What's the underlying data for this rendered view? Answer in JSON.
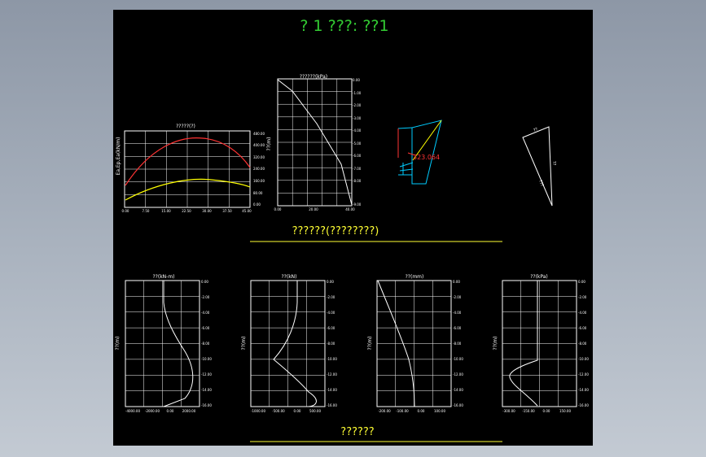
{
  "sheet_title": "? 1 ???: ??1",
  "section1_title": "??????(????????)",
  "section2_title": "??????",
  "colors": {
    "background": "#000000",
    "title_green": "#33cc33",
    "section_yellow": "#ffff33",
    "grid": "#ffffff",
    "curve": "#ffffff",
    "earth_red": "#ff3333",
    "earth_yellow": "#ffff00",
    "wall_cyan": "#00ccff",
    "callout_red": "#ff3333"
  },
  "charts": {
    "earth": {
      "title": "?????(?)",
      "ylabel": "Ea,Ep,Ea(kN/m)",
      "xticks": [
        "0.00",
        "7.50",
        "15.00",
        "22.50",
        "30.00",
        "37.50",
        "45.00"
      ],
      "yticks": [
        "480.00",
        "400.00",
        "320.00",
        "240.00",
        "160.00",
        "80.00",
        "0.00"
      ]
    },
    "pressure": {
      "title": "??????(kPa)",
      "ylabel": "??(m)",
      "xticks": [
        "0.00",
        "20.00",
        "40.00"
      ],
      "yticks": [
        "0.00",
        "-1.00",
        "-2.00",
        "-3.00",
        "-4.00",
        "-5.00",
        "-6.00",
        "-7.00",
        "-8.00",
        "-9.00"
      ]
    },
    "moment": {
      "title": "??(kN-m)",
      "ylabel": "??(m)",
      "xticks": [
        "-4000.00",
        "-2000.00",
        "0.00",
        "2000.00"
      ],
      "yticks": [
        "0.00",
        "-2.00",
        "-4.00",
        "-6.00",
        "-8.00",
        "-10.00",
        "-12.00",
        "-14.00",
        "-16.00"
      ]
    },
    "shear": {
      "title": "??(kN)",
      "ylabel": "??(m)",
      "xticks": [
        "-1000.00",
        "-500.00",
        "0.00",
        "500.00"
      ],
      "yticks": [
        "0.00",
        "-2.00",
        "-4.00",
        "-6.00",
        "-8.00",
        "-10.00",
        "-12.00",
        "-14.00",
        "-16.00"
      ]
    },
    "displacement": {
      "title": "??(mm)",
      "ylabel": "??(m)",
      "xticks": [
        "-200.00",
        "-100.00",
        "0.00",
        "100.00"
      ],
      "yticks": [
        "0.00",
        "-2.00",
        "-4.00",
        "-6.00",
        "-8.00",
        "-10.00",
        "-12.00",
        "-14.00",
        "-16.00"
      ]
    },
    "soil_pressure": {
      "title": "??(kPa)",
      "ylabel": "??(m)",
      "xticks": [
        "-300.00",
        "-150.00",
        "0.00",
        "150.00"
      ],
      "yticks": [
        "0.00",
        "-2.00",
        "-4.00",
        "-6.00",
        "-8.00",
        "-10.00",
        "-12.00",
        "-14.00",
        "-16.00"
      ]
    }
  },
  "wall_sketch": {
    "callout": "323.064"
  },
  "force_triangle": {
    "labels": [
      "??",
      "??",
      "???"
    ]
  }
}
